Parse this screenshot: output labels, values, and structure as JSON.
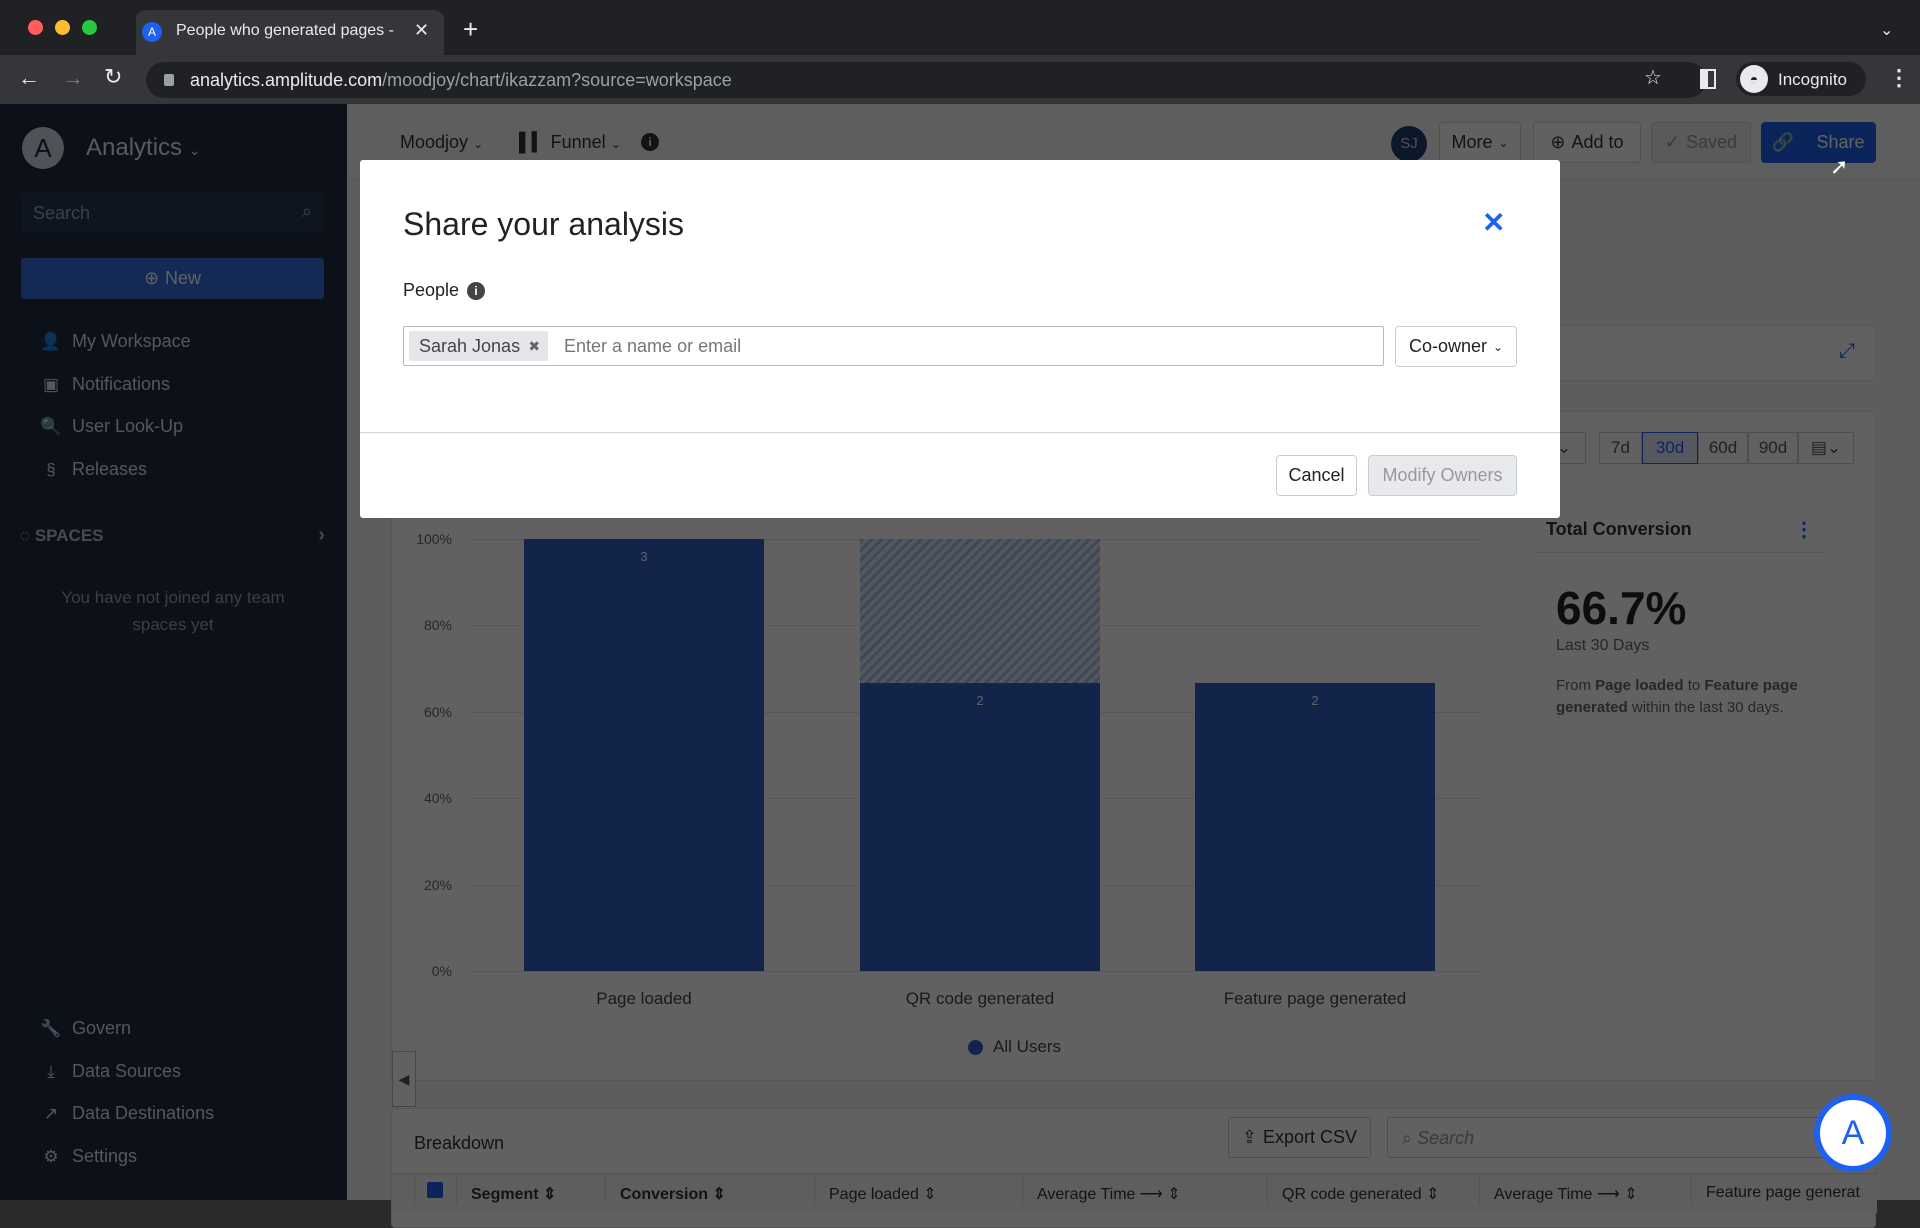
{
  "browser": {
    "tab_title": "People who generated pages -",
    "url_domain": "analytics.amplitude.com",
    "url_path": "/moodjoy/chart/ikazzam?source=workspace",
    "profile_label": "Incognito"
  },
  "sidebar": {
    "app_name": "Analytics",
    "search_placeholder": "Search",
    "new_label": "New",
    "items": [
      {
        "label": "My Workspace",
        "icon": "user-icon"
      },
      {
        "label": "Notifications",
        "icon": "inbox-icon"
      },
      {
        "label": "User Look-Up",
        "icon": "user-search-icon"
      },
      {
        "label": "Releases",
        "icon": "releases-icon"
      }
    ],
    "spaces_label": "SPACES",
    "spaces_empty": "You have not joined any team spaces yet",
    "bottom_items": [
      {
        "label": "Govern",
        "icon": "wrench-icon"
      },
      {
        "label": "Data Sources",
        "icon": "download-icon"
      },
      {
        "label": "Data Destinations",
        "icon": "export-icon"
      },
      {
        "label": "Settings",
        "icon": "gear-icon"
      }
    ]
  },
  "toolbar": {
    "project": "Moodjoy",
    "chart_type": "Funnel",
    "avatar_initials": "SJ",
    "more_label": "More",
    "add_to_label": "Add to",
    "saved_label": "Saved",
    "share_label": "Share"
  },
  "date_range": {
    "options": [
      "7d",
      "30d",
      "60d",
      "90d"
    ],
    "selected": "30d"
  },
  "chart_data": {
    "type": "bar",
    "categories": [
      "Page loaded",
      "QR code generated",
      "Feature page generated"
    ],
    "series": [
      {
        "name": "All Users",
        "values": [
          100,
          66.7,
          66.7
        ],
        "counts": [
          3,
          2,
          2
        ],
        "color": "#2f5fc4"
      }
    ],
    "dropoff_from_previous": [
      0,
      33.3,
      0
    ],
    "y_ticks": [
      "0%",
      "20%",
      "40%",
      "60%",
      "80%",
      "100%"
    ],
    "ylim": [
      0,
      100
    ],
    "grid": true,
    "legend_position": "bottom"
  },
  "summary": {
    "title": "Total Conversion",
    "value": "66.7%",
    "period": "Last 30 Days",
    "desc_prefix": "From ",
    "desc_from": "Page loaded",
    "desc_mid": " to ",
    "desc_to": "Feature page generated",
    "desc_suffix": " within the last 30 days."
  },
  "breakdown": {
    "title": "Breakdown",
    "export_label": "Export CSV",
    "search_placeholder": "Search",
    "columns": [
      "Segment",
      "Conversion",
      "Page loaded",
      "Average Time ⟶",
      "QR code generated",
      "Average Time ⟶",
      "Feature page generat"
    ]
  },
  "modal": {
    "title": "Share your analysis",
    "people_label": "People",
    "chip_name": "Sarah Jonas",
    "input_placeholder": "Enter a name or email",
    "role": "Co-owner",
    "cancel_label": "Cancel",
    "submit_label": "Modify Owners",
    "accent": "#1e61f0"
  }
}
